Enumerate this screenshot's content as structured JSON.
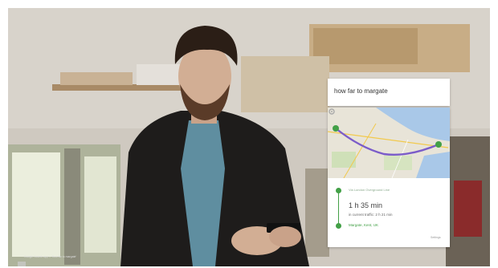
{
  "search": {
    "query": "how far to margate"
  },
  "directions": {
    "from": "Via London Overground Line",
    "duration": "1 h 35 min",
    "traffic": "in current traffic: 2 h 21 min",
    "destination": "Margate, Kent, UK"
  },
  "map": {
    "route_color": "#7b5cc9",
    "marker_color": "#43a047"
  },
  "settings": {
    "icon": "gear-icon",
    "label": "Settings"
  },
  "video": {
    "caption": "Google Search app – 'How far to margate'"
  }
}
